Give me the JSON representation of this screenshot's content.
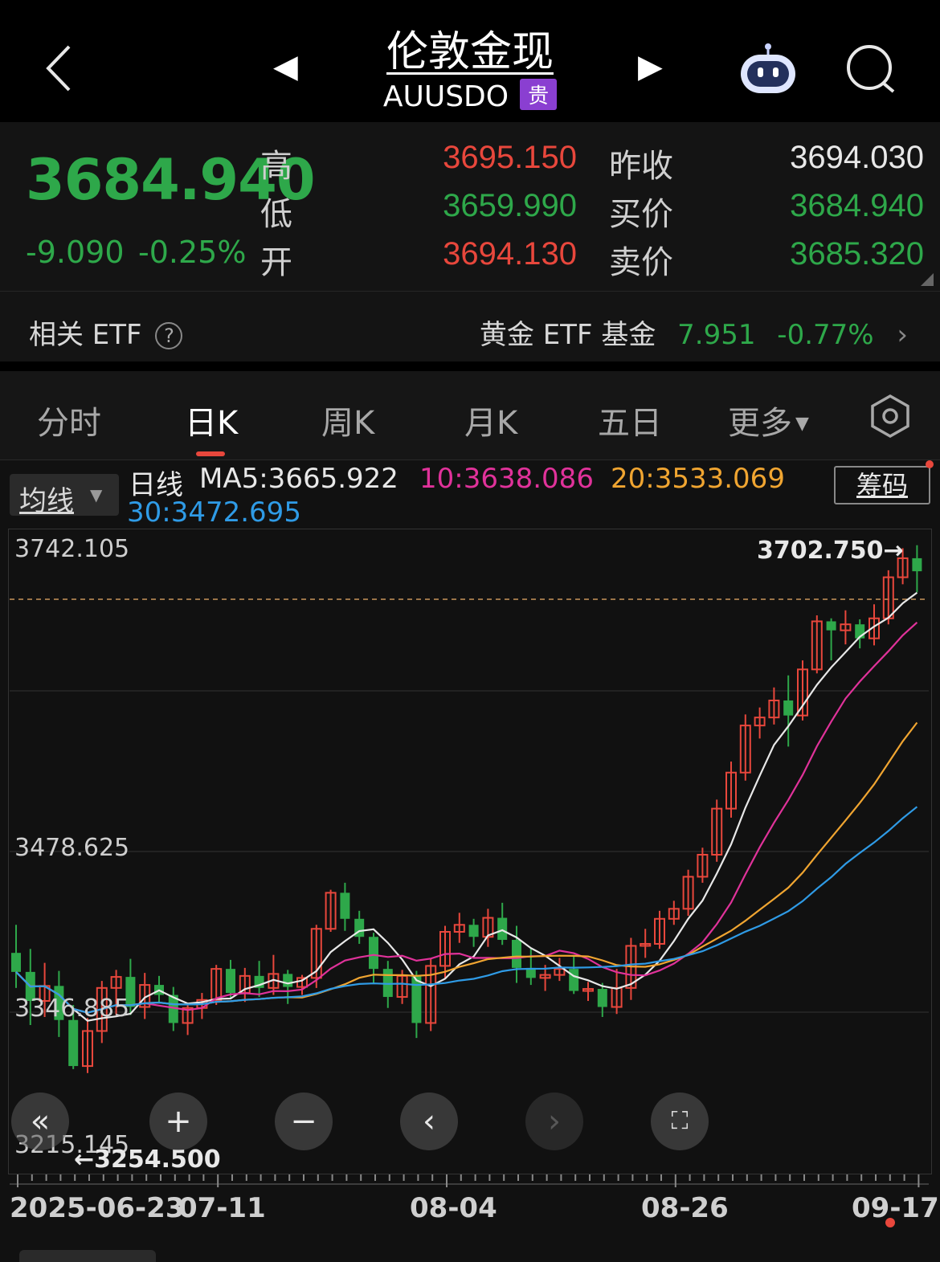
{
  "header": {
    "title": "伦敦金现",
    "code": "AUUSDO",
    "badge": "贵",
    "prev_arrow": "◀",
    "next_arrow": "▶"
  },
  "quote": {
    "price": "3684.940",
    "change": "-9.090",
    "change_pct": "-0.25%",
    "high_label": "高",
    "high": "3695.150",
    "low_label": "低",
    "low": "3659.990",
    "open_label": "开",
    "open": "3694.130",
    "prev_close_label": "昨收",
    "prev_close": "3694.030",
    "bid_label": "买价",
    "bid": "3684.940",
    "ask_label": "卖价",
    "ask": "3685.320"
  },
  "etf": {
    "label": "相关 ETF",
    "help": "?",
    "fund_name": "黄金 ETF 基金",
    "fund_price": "7.951",
    "fund_change": "-0.77%",
    "chevron": "›"
  },
  "tabs": [
    "分时",
    "日K",
    "周K",
    "月K",
    "五日",
    "更多"
  ],
  "ma_bar": {
    "selector": "均线",
    "period": "日线",
    "ma5": "MA5:3665.922",
    "ma10": "10:3638.086",
    "ma20": "20:3533.069",
    "ma30": "30:3472.695",
    "chip_button": "筹码"
  },
  "colors": {
    "up": "#e8473c",
    "down": "#2ea84a",
    "ma5": "#e8e8e8",
    "ma10": "#e0329a",
    "ma20": "#f0a531",
    "ma30": "#2f9be6"
  },
  "chart_data": {
    "type": "candlestick",
    "y_labels": [
      "3742.105",
      "3478.625",
      "3346.885",
      "3215.145"
    ],
    "ylim": [
      3215.145,
      3742.105
    ],
    "max_marker": "3702.750→",
    "min_marker": "←3254.500",
    "x_labels": [
      "2025-06-23",
      "07-11",
      "08-04",
      "08-26",
      "09-17"
    ],
    "candles": [
      [
        3368,
        3349,
        3396,
        3333
      ],
      [
        3349,
        3320,
        3372,
        3296
      ],
      [
        3320,
        3335,
        3358,
        3304
      ],
      [
        3335,
        3301,
        3350,
        3284
      ],
      [
        3301,
        3255,
        3316,
        3252
      ],
      [
        3255,
        3290,
        3303,
        3248
      ],
      [
        3290,
        3333,
        3340,
        3278
      ],
      [
        3333,
        3344,
        3351,
        3306
      ],
      [
        3344,
        3314,
        3362,
        3306
      ],
      [
        3314,
        3336,
        3348,
        3302
      ],
      [
        3336,
        3326,
        3345,
        3318
      ],
      [
        3326,
        3298,
        3334,
        3290
      ],
      [
        3298,
        3313,
        3318,
        3286
      ],
      [
        3313,
        3321,
        3328,
        3302
      ],
      [
        3321,
        3352,
        3356,
        3316
      ],
      [
        3352,
        3328,
        3361,
        3322
      ],
      [
        3328,
        3345,
        3353,
        3319
      ],
      [
        3345,
        3333,
        3360,
        3324
      ],
      [
        3333,
        3347,
        3366,
        3326
      ],
      [
        3347,
        3334,
        3351,
        3317
      ],
      [
        3334,
        3343,
        3346,
        3326
      ],
      [
        3343,
        3392,
        3396,
        3333
      ],
      [
        3392,
        3428,
        3431,
        3389
      ],
      [
        3428,
        3402,
        3438,
        3390
      ],
      [
        3402,
        3384,
        3410,
        3377
      ],
      [
        3384,
        3352,
        3388,
        3338
      ],
      [
        3352,
        3324,
        3360,
        3313
      ],
      [
        3324,
        3345,
        3351,
        3317
      ],
      [
        3345,
        3298,
        3350,
        3283
      ],
      [
        3298,
        3355,
        3362,
        3290
      ],
      [
        3355,
        3389,
        3395,
        3342
      ],
      [
        3389,
        3396,
        3408,
        3378
      ],
      [
        3396,
        3384,
        3402,
        3374
      ],
      [
        3384,
        3403,
        3412,
        3374
      ],
      [
        3403,
        3381,
        3418,
        3376
      ],
      [
        3381,
        3353,
        3395,
        3338
      ],
      [
        3353,
        3343,
        3372,
        3336
      ],
      [
        3343,
        3346,
        3356,
        3330
      ],
      [
        3346,
        3352,
        3363,
        3340
      ],
      [
        3352,
        3330,
        3366,
        3327
      ],
      [
        3330,
        3332,
        3339,
        3320
      ],
      [
        3332,
        3314,
        3338,
        3304
      ],
      [
        3314,
        3333,
        3352,
        3307
      ],
      [
        3333,
        3375,
        3383,
        3321
      ],
      [
        3375,
        3377,
        3392,
        3363
      ],
      [
        3377,
        3402,
        3410,
        3372
      ],
      [
        3402,
        3412,
        3420,
        3396
      ],
      [
        3412,
        3444,
        3451,
        3405
      ],
      [
        3444,
        3466,
        3473,
        3438
      ],
      [
        3466,
        3512,
        3521,
        3459
      ],
      [
        3512,
        3548,
        3559,
        3503
      ],
      [
        3548,
        3595,
        3606,
        3540
      ],
      [
        3595,
        3603,
        3613,
        3582
      ],
      [
        3603,
        3620,
        3633,
        3596
      ],
      [
        3620,
        3605,
        3645,
        3574
      ],
      [
        3605,
        3651,
        3660,
        3600
      ],
      [
        3651,
        3699,
        3705,
        3647
      ],
      [
        3699,
        3690,
        3702,
        3660
      ],
      [
        3690,
        3696,
        3710,
        3676
      ],
      [
        3696,
        3682,
        3701,
        3672
      ],
      [
        3682,
        3702,
        3716,
        3675
      ],
      [
        3702,
        3743,
        3750,
        3696
      ],
      [
        3743,
        3762,
        3772,
        3736
      ],
      [
        3762,
        3749,
        3775,
        3728
      ]
    ]
  }
}
